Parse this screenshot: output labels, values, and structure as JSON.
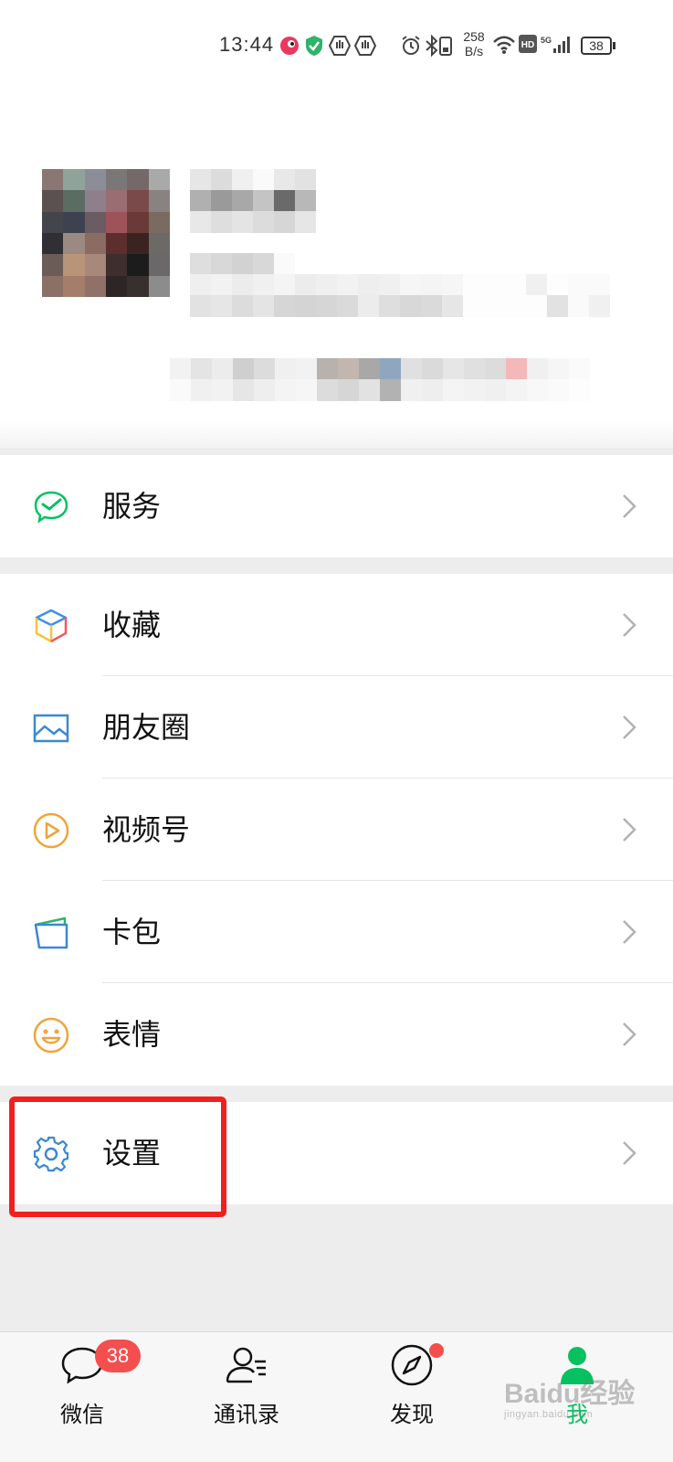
{
  "status_bar": {
    "time": "13:44",
    "net_speed_value": "258",
    "net_speed_unit": "B/s",
    "battery": "38",
    "icons": [
      "app-notification-icon",
      "shield-icon",
      "hand-icon",
      "hand-icon",
      "alarm-icon",
      "bluetooth-icon",
      "vibrate-icon",
      "wifi-icon",
      "hd-icon",
      "5g-signal-icon",
      "battery-icon"
    ]
  },
  "menu": {
    "service": "服务",
    "favorites": "收藏",
    "moments": "朋友圈",
    "channels": "视频号",
    "cards": "卡包",
    "stickers": "表情",
    "settings": "设置"
  },
  "tabs": {
    "chats": "微信",
    "contacts": "通讯录",
    "discover": "发现",
    "me": "我",
    "chats_badge": "38"
  },
  "colors": {
    "accent_green": "#07c160",
    "badge_red": "#f44e4e",
    "highlight_red": "#f21f1f"
  },
  "watermark": {
    "brand": "Baidu经验",
    "url": "jingyan.baidu.com"
  }
}
